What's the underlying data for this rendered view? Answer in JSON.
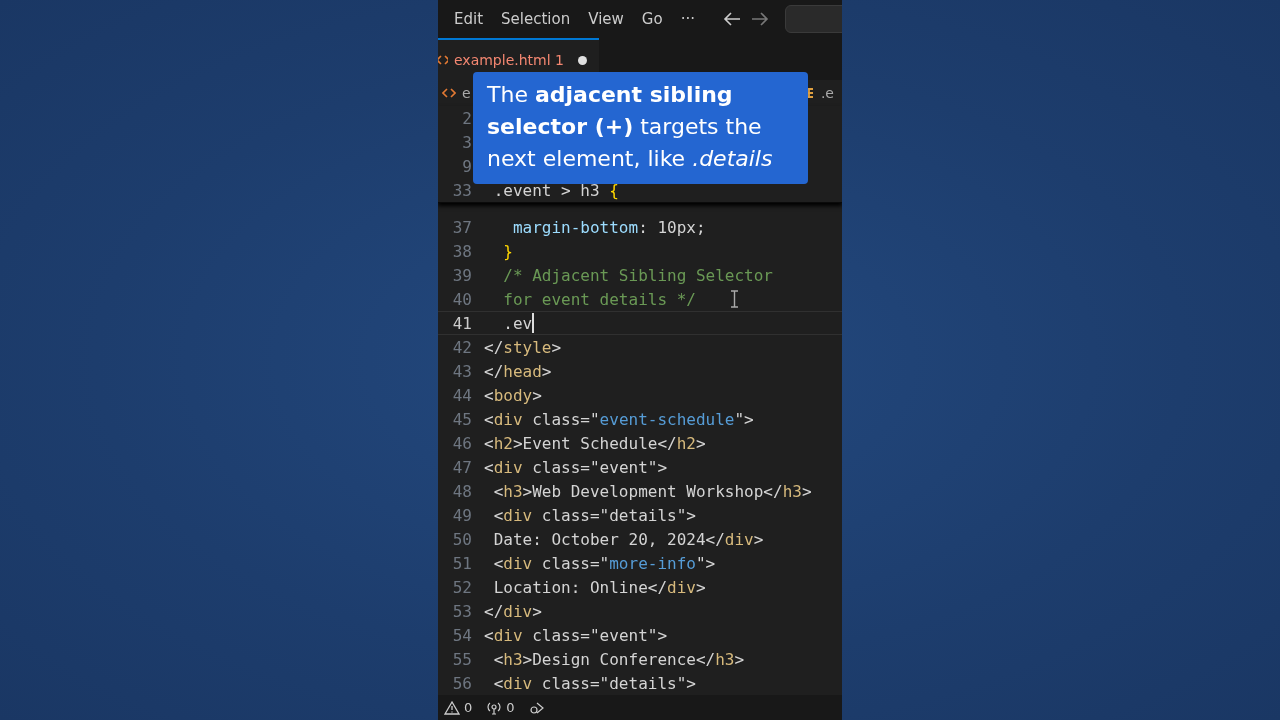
{
  "menu": {
    "items": [
      "Edit",
      "Selection",
      "View",
      "Go"
    ],
    "more": "···"
  },
  "tabs": [
    {
      "label": "example.html",
      "problems": "1",
      "selected": true,
      "modified": true
    }
  ],
  "breadcrumb": {
    "left": "e",
    "right": ".e"
  },
  "sticky_lines": [
    {
      "number": "2"
    },
    {
      "number": "3"
    },
    {
      "number": "9"
    },
    {
      "number": "33",
      "tokens": [
        {
          "kind": "text",
          "text": " .event > h3 "
        },
        {
          "kind": "brace",
          "text": "{"
        }
      ]
    }
  ],
  "tooltip": "The **adjacent sibling selector (+)** targets the next element, like *.details*",
  "lines": [
    {
      "number": "37",
      "current": false,
      "tokens": [
        {
          "kind": "prop",
          "text": "   margin-bottom"
        },
        {
          "kind": "text",
          "text": ": 10px;"
        }
      ]
    },
    {
      "number": "38",
      "current": false,
      "tokens": [
        {
          "kind": "brace",
          "text": "  }"
        }
      ]
    },
    {
      "number": "39",
      "current": false,
      "tokens": [
        {
          "kind": "comment",
          "text": "  /* Adjacent Sibling Selector"
        }
      ]
    },
    {
      "number": "40",
      "current": false,
      "tokens": [
        {
          "kind": "comment",
          "text": "  for event details */"
        }
      ]
    },
    {
      "number": "41",
      "current": true,
      "tokens": [
        {
          "kind": "text",
          "text": "  .ev"
        }
      ]
    },
    {
      "number": "42",
      "current": false,
      "tokens": [
        {
          "kind": "text",
          "text": "</"
        },
        {
          "kind": "tag",
          "text": "style"
        },
        {
          "kind": "text",
          "text": ">"
        }
      ]
    },
    {
      "number": "43",
      "current": false,
      "tokens": [
        {
          "kind": "text",
          "text": "</"
        },
        {
          "kind": "tag",
          "text": "head"
        },
        {
          "kind": "text",
          "text": ">"
        }
      ]
    },
    {
      "number": "44",
      "current": false,
      "tokens": [
        {
          "kind": "text",
          "text": "<"
        },
        {
          "kind": "tag",
          "text": "body"
        },
        {
          "kind": "text",
          "text": ">"
        }
      ]
    },
    {
      "number": "45",
      "current": false,
      "tokens": [
        {
          "kind": "text",
          "text": "<"
        },
        {
          "kind": "tag",
          "text": "div"
        },
        {
          "kind": "text",
          "text": " class=\""
        },
        {
          "kind": "value",
          "text": "event-schedule"
        },
        {
          "kind": "text",
          "text": "\">"
        }
      ]
    },
    {
      "number": "46",
      "current": false,
      "tokens": [
        {
          "kind": "text",
          "text": "<"
        },
        {
          "kind": "tag",
          "text": "h2"
        },
        {
          "kind": "text",
          "text": ">Event Schedule</"
        },
        {
          "kind": "tag",
          "text": "h2"
        },
        {
          "kind": "text",
          "text": ">"
        }
      ]
    },
    {
      "number": "47",
      "current": false,
      "tokens": [
        {
          "kind": "text",
          "text": "<"
        },
        {
          "kind": "tag",
          "text": "div"
        },
        {
          "kind": "text",
          "text": " class=\"event\">"
        }
      ]
    },
    {
      "number": "48",
      "current": false,
      "tokens": [
        {
          "kind": "text",
          "text": " <"
        },
        {
          "kind": "tag",
          "text": "h3"
        },
        {
          "kind": "text",
          "text": ">Web Development Workshop</"
        },
        {
          "kind": "tag",
          "text": "h3"
        },
        {
          "kind": "text",
          "text": ">"
        }
      ]
    },
    {
      "number": "49",
      "current": false,
      "tokens": [
        {
          "kind": "text",
          "text": " <"
        },
        {
          "kind": "tag",
          "text": "div"
        },
        {
          "kind": "text",
          "text": " class=\"details\">"
        }
      ]
    },
    {
      "number": "50",
      "current": false,
      "tokens": [
        {
          "kind": "text",
          "text": " Date: October 20, 2024</"
        },
        {
          "kind": "tag",
          "text": "div"
        },
        {
          "kind": "text",
          "text": ">"
        }
      ]
    },
    {
      "number": "51",
      "current": false,
      "tokens": [
        {
          "kind": "text",
          "text": " <"
        },
        {
          "kind": "tag",
          "text": "div"
        },
        {
          "kind": "text",
          "text": " class=\""
        },
        {
          "kind": "value",
          "text": "more-info"
        },
        {
          "kind": "text",
          "text": "\">"
        }
      ]
    },
    {
      "number": "52",
      "current": false,
      "tokens": [
        {
          "kind": "text",
          "text": " Location: Online</"
        },
        {
          "kind": "tag",
          "text": "div"
        },
        {
          "kind": "text",
          "text": ">"
        }
      ]
    },
    {
      "number": "53",
      "current": false,
      "tokens": [
        {
          "kind": "text",
          "text": "</"
        },
        {
          "kind": "tag",
          "text": "div"
        },
        {
          "kind": "text",
          "text": ">"
        }
      ]
    },
    {
      "number": "54",
      "current": false,
      "tokens": [
        {
          "kind": "text",
          "text": "<"
        },
        {
          "kind": "tag",
          "text": "div"
        },
        {
          "kind": "text",
          "text": " class=\"event\">"
        }
      ]
    },
    {
      "number": "55",
      "current": false,
      "tokens": [
        {
          "kind": "text",
          "text": " <"
        },
        {
          "kind": "tag",
          "text": "h3"
        },
        {
          "kind": "text",
          "text": ">Design Conference</"
        },
        {
          "kind": "tag",
          "text": "h3"
        },
        {
          "kind": "text",
          "text": ">"
        }
      ]
    },
    {
      "number": "56",
      "current": false,
      "tokens": [
        {
          "kind": "text",
          "text": " <"
        },
        {
          "kind": "tag",
          "text": "div"
        },
        {
          "kind": "text",
          "text": " class=\"details\">"
        }
      ]
    }
  ],
  "status_bar": {
    "errors": "0",
    "ports": "0"
  }
}
